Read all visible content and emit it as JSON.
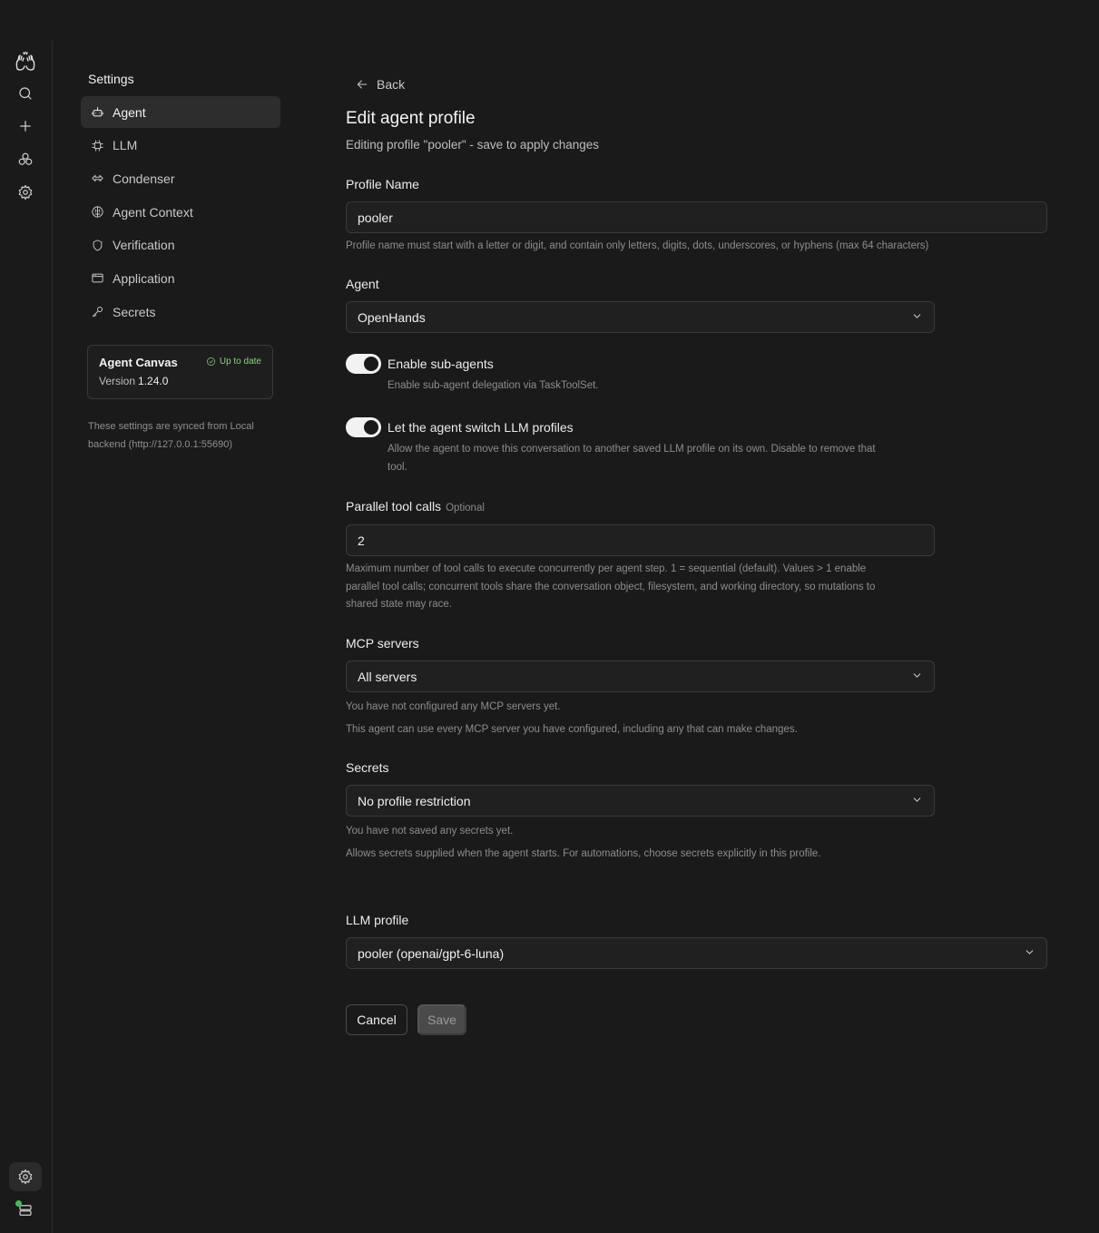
{
  "rail": {
    "icons": [
      "logo-hands-icon",
      "search-icon",
      "plus-icon",
      "modules-icon",
      "settings-gear-icon",
      "settings-gear-icon",
      "server-status-icon"
    ]
  },
  "settings_nav": {
    "title": "Settings",
    "items": [
      {
        "label": "Agent",
        "icon": "agent-icon",
        "active": true
      },
      {
        "label": "LLM",
        "icon": "chip-icon",
        "active": false
      },
      {
        "label": "Condenser",
        "icon": "condenser-icon",
        "active": false
      },
      {
        "label": "Agent Context",
        "icon": "brain-icon",
        "active": false
      },
      {
        "label": "Verification",
        "icon": "shield-icon",
        "active": false
      },
      {
        "label": "Application",
        "icon": "window-icon",
        "active": false
      },
      {
        "label": "Secrets",
        "icon": "key-icon",
        "active": false
      }
    ]
  },
  "canvas_card": {
    "name": "Agent Canvas",
    "status": "Up to date",
    "version_label": "Version",
    "version": "1.24.0"
  },
  "sync_note": "These settings are synced from Local backend (http://127.0.0.1:55690)",
  "main": {
    "back_label": "Back",
    "title": "Edit agent profile",
    "subtitle": "Editing profile \"pooler\" - save to apply changes",
    "profile_name": {
      "label": "Profile Name",
      "value": "pooler",
      "help": "Profile name must start with a letter or digit, and contain only letters, digits, dots, underscores, or hyphens (max 64 characters)"
    },
    "agent": {
      "label": "Agent",
      "value": "OpenHands"
    },
    "sub_agents": {
      "label": "Enable sub-agents",
      "help": "Enable sub-agent delegation via TaskToolSet.",
      "enabled": true
    },
    "switch_llm": {
      "label": "Let the agent switch LLM profiles",
      "help_line1": "Allow the agent to move this conversation to another saved LLM profile on its own. Disable to remove that",
      "help_line2": "tool.",
      "enabled": true
    },
    "parallel_tool_calls": {
      "label": "Parallel tool calls",
      "optional": "Optional",
      "value": "2",
      "help_line1": "Maximum number of tool calls to execute concurrently per agent step. 1 = sequential (default). Values > 1 enable",
      "help_line2": "parallel tool calls; concurrent tools share the conversation object, filesystem, and working directory, so mutations to",
      "help_line3": "shared state may race."
    },
    "mcp_servers": {
      "label": "MCP servers",
      "value": "All servers",
      "help_line1": "You have not configured any MCP servers yet.",
      "help_line2": "This agent can use every MCP server you have configured, including any that can make changes."
    },
    "secrets": {
      "label": "Secrets",
      "value": "No profile restriction",
      "help_line1": "You have not saved any secrets yet.",
      "help_line2": "Allows secrets supplied when the agent starts. For automations, choose secrets explicitly in this profile."
    },
    "llm_profile": {
      "label": "LLM profile",
      "value": "pooler (openai/gpt-6-luna)"
    },
    "cancel_label": "Cancel",
    "save_label": "Save"
  }
}
